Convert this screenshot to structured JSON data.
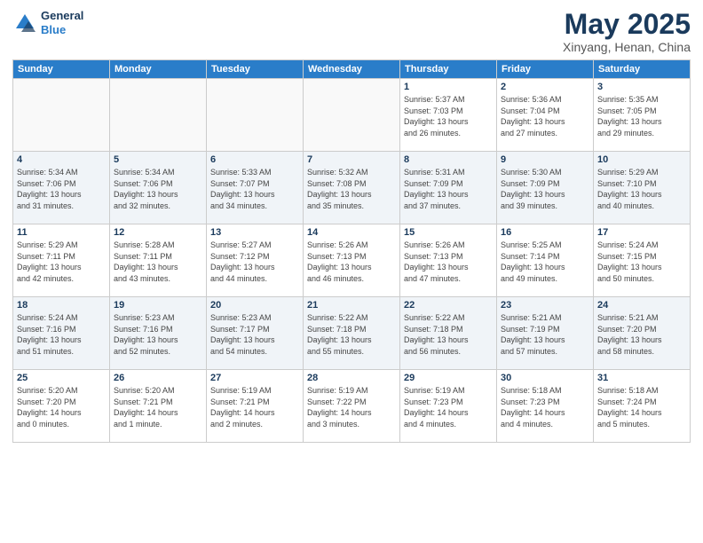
{
  "header": {
    "logo_line1": "General",
    "logo_line2": "Blue",
    "month_title": "May 2025",
    "subtitle": "Xinyang, Henan, China"
  },
  "weekdays": [
    "Sunday",
    "Monday",
    "Tuesday",
    "Wednesday",
    "Thursday",
    "Friday",
    "Saturday"
  ],
  "weeks": [
    {
      "shaded": false,
      "days": [
        {
          "num": "",
          "info": ""
        },
        {
          "num": "",
          "info": ""
        },
        {
          "num": "",
          "info": ""
        },
        {
          "num": "",
          "info": ""
        },
        {
          "num": "1",
          "info": "Sunrise: 5:37 AM\nSunset: 7:03 PM\nDaylight: 13 hours\nand 26 minutes."
        },
        {
          "num": "2",
          "info": "Sunrise: 5:36 AM\nSunset: 7:04 PM\nDaylight: 13 hours\nand 27 minutes."
        },
        {
          "num": "3",
          "info": "Sunrise: 5:35 AM\nSunset: 7:05 PM\nDaylight: 13 hours\nand 29 minutes."
        }
      ]
    },
    {
      "shaded": true,
      "days": [
        {
          "num": "4",
          "info": "Sunrise: 5:34 AM\nSunset: 7:06 PM\nDaylight: 13 hours\nand 31 minutes."
        },
        {
          "num": "5",
          "info": "Sunrise: 5:34 AM\nSunset: 7:06 PM\nDaylight: 13 hours\nand 32 minutes."
        },
        {
          "num": "6",
          "info": "Sunrise: 5:33 AM\nSunset: 7:07 PM\nDaylight: 13 hours\nand 34 minutes."
        },
        {
          "num": "7",
          "info": "Sunrise: 5:32 AM\nSunset: 7:08 PM\nDaylight: 13 hours\nand 35 minutes."
        },
        {
          "num": "8",
          "info": "Sunrise: 5:31 AM\nSunset: 7:09 PM\nDaylight: 13 hours\nand 37 minutes."
        },
        {
          "num": "9",
          "info": "Sunrise: 5:30 AM\nSunset: 7:09 PM\nDaylight: 13 hours\nand 39 minutes."
        },
        {
          "num": "10",
          "info": "Sunrise: 5:29 AM\nSunset: 7:10 PM\nDaylight: 13 hours\nand 40 minutes."
        }
      ]
    },
    {
      "shaded": false,
      "days": [
        {
          "num": "11",
          "info": "Sunrise: 5:29 AM\nSunset: 7:11 PM\nDaylight: 13 hours\nand 42 minutes."
        },
        {
          "num": "12",
          "info": "Sunrise: 5:28 AM\nSunset: 7:11 PM\nDaylight: 13 hours\nand 43 minutes."
        },
        {
          "num": "13",
          "info": "Sunrise: 5:27 AM\nSunset: 7:12 PM\nDaylight: 13 hours\nand 44 minutes."
        },
        {
          "num": "14",
          "info": "Sunrise: 5:26 AM\nSunset: 7:13 PM\nDaylight: 13 hours\nand 46 minutes."
        },
        {
          "num": "15",
          "info": "Sunrise: 5:26 AM\nSunset: 7:13 PM\nDaylight: 13 hours\nand 47 minutes."
        },
        {
          "num": "16",
          "info": "Sunrise: 5:25 AM\nSunset: 7:14 PM\nDaylight: 13 hours\nand 49 minutes."
        },
        {
          "num": "17",
          "info": "Sunrise: 5:24 AM\nSunset: 7:15 PM\nDaylight: 13 hours\nand 50 minutes."
        }
      ]
    },
    {
      "shaded": true,
      "days": [
        {
          "num": "18",
          "info": "Sunrise: 5:24 AM\nSunset: 7:16 PM\nDaylight: 13 hours\nand 51 minutes."
        },
        {
          "num": "19",
          "info": "Sunrise: 5:23 AM\nSunset: 7:16 PM\nDaylight: 13 hours\nand 52 minutes."
        },
        {
          "num": "20",
          "info": "Sunrise: 5:23 AM\nSunset: 7:17 PM\nDaylight: 13 hours\nand 54 minutes."
        },
        {
          "num": "21",
          "info": "Sunrise: 5:22 AM\nSunset: 7:18 PM\nDaylight: 13 hours\nand 55 minutes."
        },
        {
          "num": "22",
          "info": "Sunrise: 5:22 AM\nSunset: 7:18 PM\nDaylight: 13 hours\nand 56 minutes."
        },
        {
          "num": "23",
          "info": "Sunrise: 5:21 AM\nSunset: 7:19 PM\nDaylight: 13 hours\nand 57 minutes."
        },
        {
          "num": "24",
          "info": "Sunrise: 5:21 AM\nSunset: 7:20 PM\nDaylight: 13 hours\nand 58 minutes."
        }
      ]
    },
    {
      "shaded": false,
      "days": [
        {
          "num": "25",
          "info": "Sunrise: 5:20 AM\nSunset: 7:20 PM\nDaylight: 14 hours\nand 0 minutes."
        },
        {
          "num": "26",
          "info": "Sunrise: 5:20 AM\nSunset: 7:21 PM\nDaylight: 14 hours\nand 1 minute."
        },
        {
          "num": "27",
          "info": "Sunrise: 5:19 AM\nSunset: 7:21 PM\nDaylight: 14 hours\nand 2 minutes."
        },
        {
          "num": "28",
          "info": "Sunrise: 5:19 AM\nSunset: 7:22 PM\nDaylight: 14 hours\nand 3 minutes."
        },
        {
          "num": "29",
          "info": "Sunrise: 5:19 AM\nSunset: 7:23 PM\nDaylight: 14 hours\nand 4 minutes."
        },
        {
          "num": "30",
          "info": "Sunrise: 5:18 AM\nSunset: 7:23 PM\nDaylight: 14 hours\nand 4 minutes."
        },
        {
          "num": "31",
          "info": "Sunrise: 5:18 AM\nSunset: 7:24 PM\nDaylight: 14 hours\nand 5 minutes."
        }
      ]
    }
  ]
}
